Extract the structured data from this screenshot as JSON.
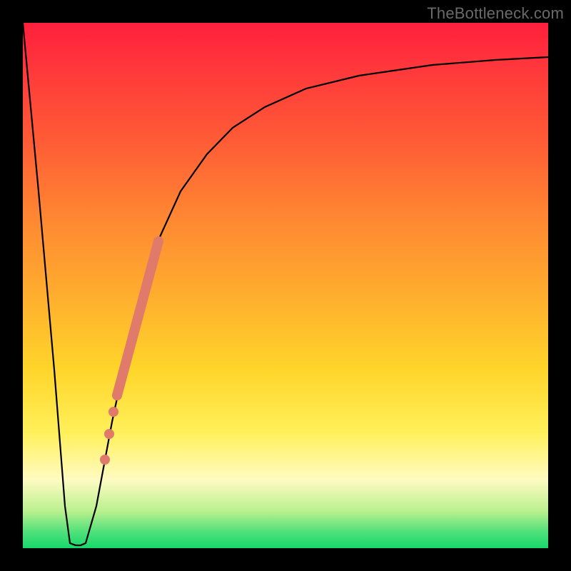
{
  "watermark": "TheBottleneck.com",
  "chart_data": {
    "type": "line",
    "title": "",
    "xlabel": "",
    "ylabel": "",
    "xlim": [
      0,
      100
    ],
    "ylim": [
      0,
      100
    ],
    "background_gradient": {
      "stops": [
        {
          "pos": 0,
          "color": "#ff1f3d"
        },
        {
          "pos": 10,
          "color": "#ff3b3b"
        },
        {
          "pos": 22,
          "color": "#ff5a36"
        },
        {
          "pos": 36,
          "color": "#ff8432"
        },
        {
          "pos": 52,
          "color": "#ffae2e"
        },
        {
          "pos": 66,
          "color": "#ffd52a"
        },
        {
          "pos": 78,
          "color": "#fff05a"
        },
        {
          "pos": 87,
          "color": "#fffbc2"
        },
        {
          "pos": 93,
          "color": "#b9f08e"
        },
        {
          "pos": 97,
          "color": "#4de07a"
        },
        {
          "pos": 100,
          "color": "#17d86b"
        }
      ]
    },
    "series": [
      {
        "name": "bottleneck-curve",
        "color": "#000000",
        "stroke_width": 2,
        "x": [
          0,
          3,
          6,
          8,
          9,
          10,
          11,
          12,
          14,
          17,
          20,
          23,
          26,
          30,
          35,
          40,
          46,
          54,
          64,
          78,
          90,
          100
        ],
        "y": [
          100,
          68,
          34,
          8,
          1,
          0.5,
          0.5,
          1,
          8,
          24,
          38,
          50,
          59,
          68,
          75,
          80,
          84,
          87.5,
          90,
          92,
          93,
          93.5
        ]
      }
    ],
    "marker_segment": {
      "name": "highlighted-range",
      "color": "#e07a6b",
      "x_range": [
        18,
        26
      ],
      "y_range": [
        30,
        59
      ],
      "stroke_width": 12
    },
    "marker_dots": {
      "name": "highlighted-points",
      "color": "#e07a6b",
      "radius": 6,
      "points": [
        {
          "x": 17.3,
          "y": 26.5
        },
        {
          "x": 16.5,
          "y": 22
        },
        {
          "x": 15.7,
          "y": 17
        }
      ]
    }
  }
}
